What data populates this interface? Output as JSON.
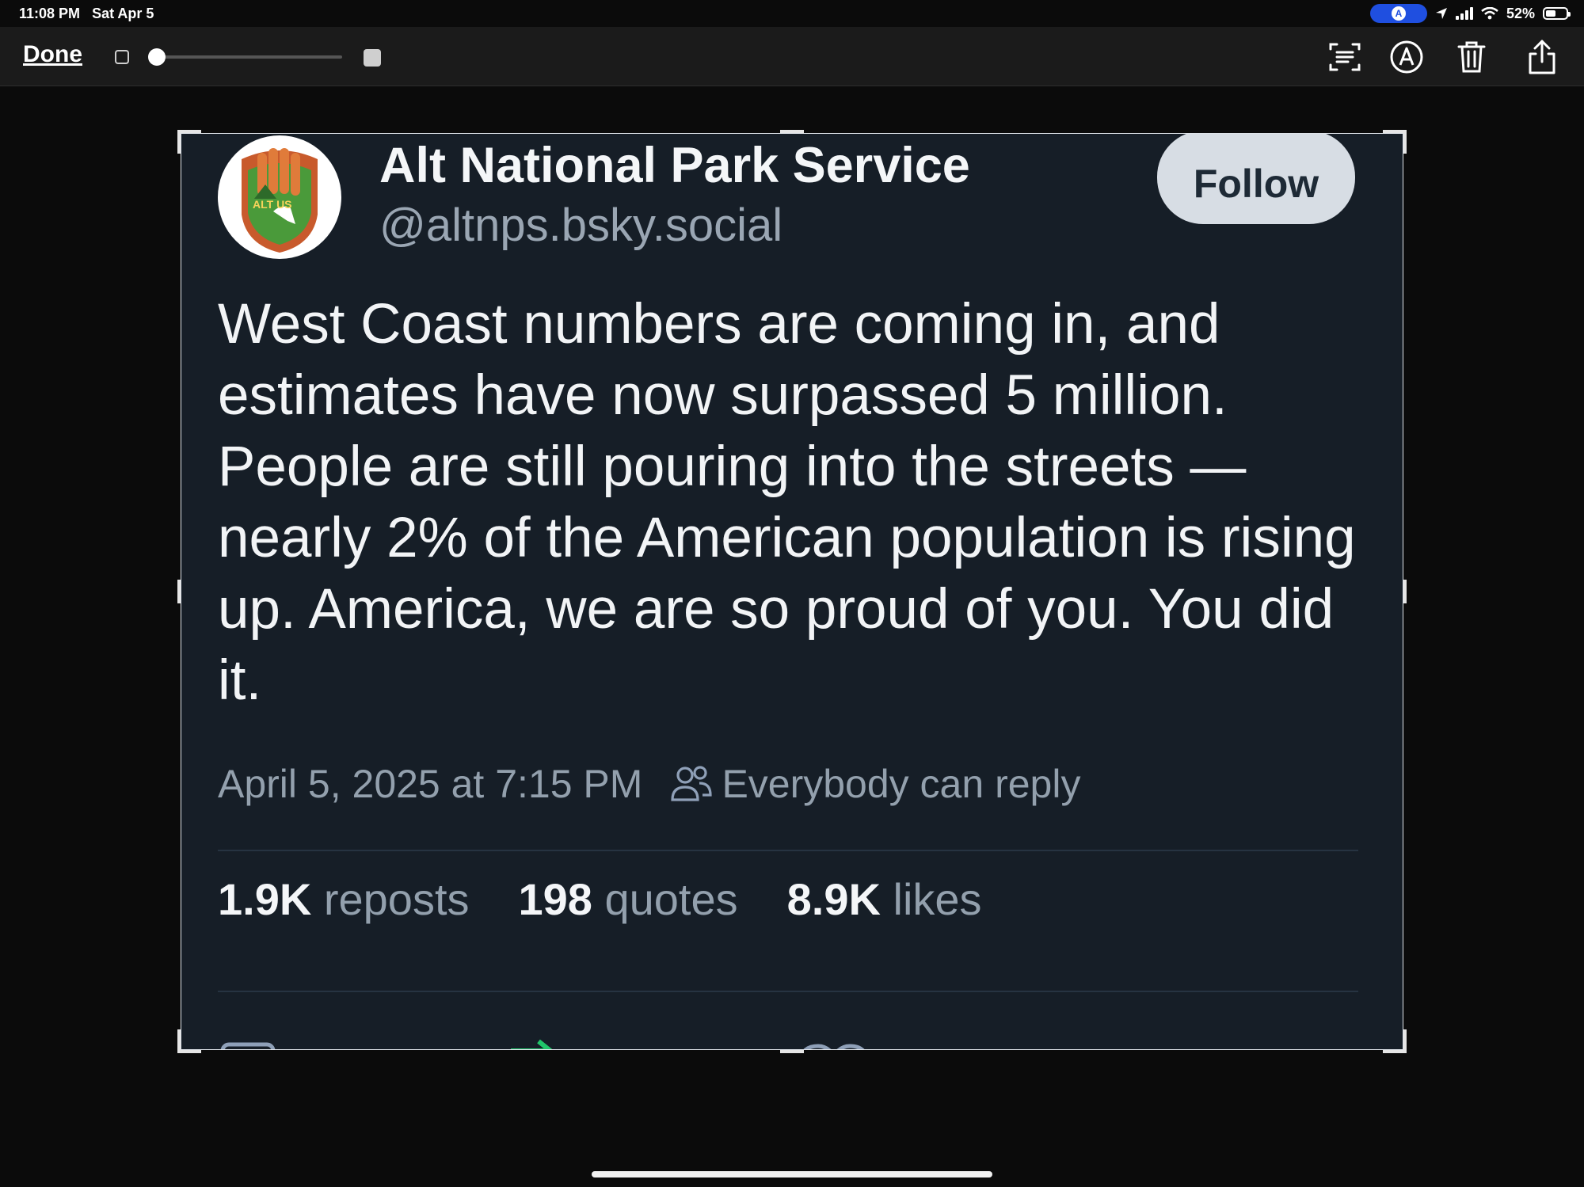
{
  "status_bar": {
    "time": "11:08 PM",
    "date": "Sat Apr 5",
    "battery": "52%",
    "battery_level": 0.52
  },
  "toolbar": {
    "done_label": "Done",
    "zoom_slider_value": 0.0,
    "icons": [
      "text-select-icon",
      "markup-icon",
      "trash-icon",
      "share-icon"
    ]
  },
  "post": {
    "author_name": "Alt National Park Service",
    "author_handle": "@altnps.bsky.social",
    "avatar_text": "ALT US",
    "follow_label": "Follow",
    "text": "West Coast numbers are coming in, and estimates have now surpassed 5 million. People are still pouring into the streets —nearly 2% of the American population is rising up. America, we are so proud of you. You did it.",
    "timestamp": "April 5, 2025 at 7:15 PM",
    "reply_setting": "Everybody can reply",
    "stats": [
      {
        "count": "1.9K",
        "label": "reposts"
      },
      {
        "count": "198",
        "label": "quotes"
      },
      {
        "count": "8.9K",
        "label": "likes"
      }
    ]
  },
  "colors": {
    "background": "#0b0b0b",
    "toolbar": "#1b1b1b",
    "post_background": "#161e27",
    "follow_button": "#d7dde4",
    "accent_status_pill": "#1f4fe0",
    "repost_green": "#20c56a"
  }
}
